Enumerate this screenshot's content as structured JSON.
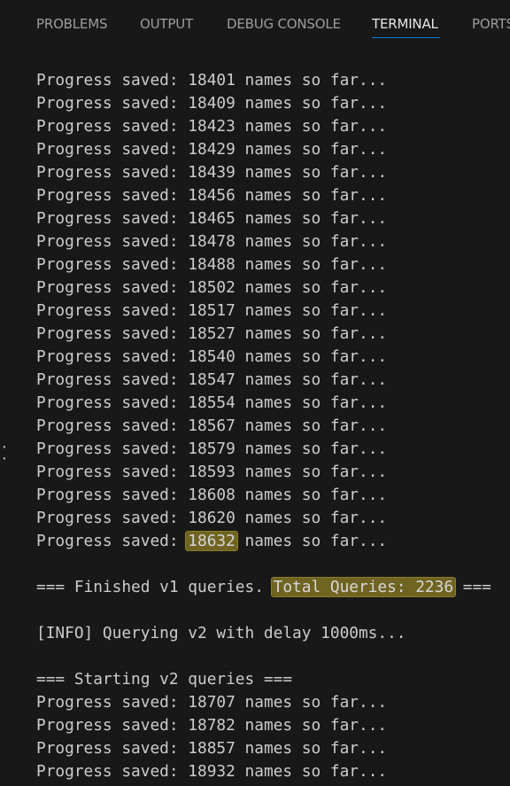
{
  "panel": {
    "tabs": [
      {
        "label": "PROBLEMS",
        "active": false
      },
      {
        "label": "OUTPUT",
        "active": false
      },
      {
        "label": "DEBUG CONSOLE",
        "active": false
      },
      {
        "label": "TERMINAL",
        "active": true
      },
      {
        "label": "PORTS",
        "active": false
      }
    ]
  },
  "terminal": {
    "lines": [
      {
        "pre": "Progress saved: ",
        "value": "18401",
        "post": " names so far..."
      },
      {
        "pre": "Progress saved: ",
        "value": "18409",
        "post": " names so far..."
      },
      {
        "pre": "Progress saved: ",
        "value": "18423",
        "post": " names so far..."
      },
      {
        "pre": "Progress saved: ",
        "value": "18429",
        "post": " names so far..."
      },
      {
        "pre": "Progress saved: ",
        "value": "18439",
        "post": " names so far..."
      },
      {
        "pre": "Progress saved: ",
        "value": "18456",
        "post": " names so far..."
      },
      {
        "pre": "Progress saved: ",
        "value": "18465",
        "post": " names so far..."
      },
      {
        "pre": "Progress saved: ",
        "value": "18478",
        "post": " names so far..."
      },
      {
        "pre": "Progress saved: ",
        "value": "18488",
        "post": " names so far..."
      },
      {
        "pre": "Progress saved: ",
        "value": "18502",
        "post": " names so far..."
      },
      {
        "pre": "Progress saved: ",
        "value": "18517",
        "post": " names so far..."
      },
      {
        "pre": "Progress saved: ",
        "value": "18527",
        "post": " names so far..."
      },
      {
        "pre": "Progress saved: ",
        "value": "18540",
        "post": " names so far..."
      },
      {
        "pre": "Progress saved: ",
        "value": "18547",
        "post": " names so far..."
      },
      {
        "pre": "Progress saved: ",
        "value": "18554",
        "post": " names so far..."
      },
      {
        "pre": "Progress saved: ",
        "value": "18567",
        "post": " names so far..."
      },
      {
        "pre": "Progress saved: ",
        "value": "18579",
        "post": " names so far..."
      },
      {
        "pre": "Progress saved: ",
        "value": "18593",
        "post": " names so far..."
      },
      {
        "pre": "Progress saved: ",
        "value": "18608",
        "post": " names so far..."
      },
      {
        "pre": "Progress saved: ",
        "value": "18620",
        "post": " names so far..."
      },
      {
        "pre": "Progress saved: ",
        "value": "18632",
        "post": " names so far...",
        "highlight": true
      },
      {
        "pre": "",
        "value": "",
        "post": ""
      },
      {
        "pre": "=== Finished v1 queries. ",
        "value": "Total Queries: 2236",
        "post": " ===",
        "highlight": true
      },
      {
        "pre": "",
        "value": "",
        "post": ""
      },
      {
        "pre": "[INFO] Querying v2 with delay 1000ms...",
        "value": "",
        "post": ""
      },
      {
        "pre": "",
        "value": "",
        "post": ""
      },
      {
        "pre": "=== Starting v2 queries ===",
        "value": "",
        "post": ""
      },
      {
        "pre": "Progress saved: ",
        "value": "18707",
        "post": " names so far..."
      },
      {
        "pre": "Progress saved: ",
        "value": "18782",
        "post": " names so far..."
      },
      {
        "pre": "Progress saved: ",
        "value": "18857",
        "post": " names so far..."
      },
      {
        "pre": "Progress saved: ",
        "value": "18932",
        "post": " names so far..."
      }
    ]
  },
  "colors": {
    "background": "#181818",
    "text": "#cccccc",
    "tab_inactive": "#9d9d9d",
    "tab_active": "#e7e7e7",
    "tab_active_underline": "#0078d4",
    "highlight": "#6f6422"
  }
}
